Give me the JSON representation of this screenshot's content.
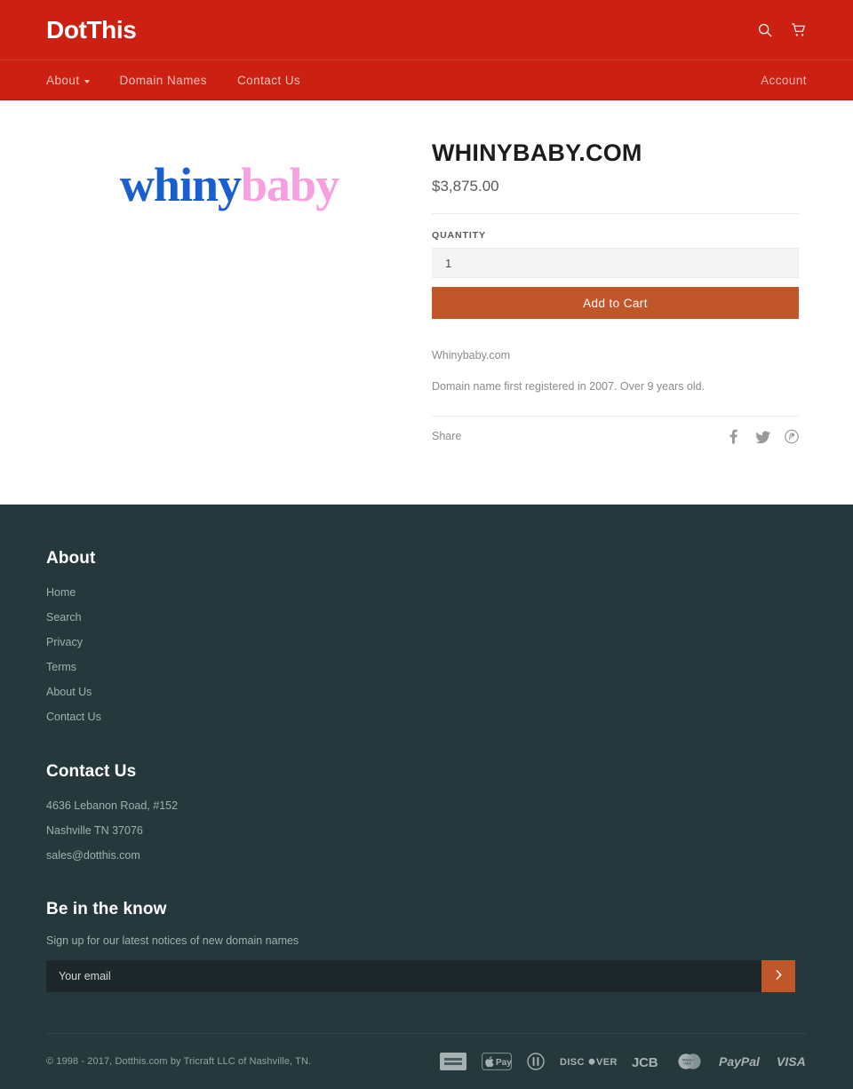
{
  "header": {
    "brand": "DotThis",
    "search_icon": "search-icon",
    "cart_icon": "cart-icon"
  },
  "nav": {
    "items": [
      {
        "label": "About",
        "has_caret": true
      },
      {
        "label": "Domain Names",
        "has_caret": false
      },
      {
        "label": "Contact Us",
        "has_caret": false
      }
    ],
    "account_label": "Account"
  },
  "product": {
    "logo_part_one": "whiny",
    "logo_part_two": "baby",
    "logo_color_one": "#1a5fd0",
    "logo_color_two": "#f79fdf",
    "title": "WHINYBABY.COM",
    "price": "$3,875.00",
    "quantity_label": "QUANTITY",
    "quantity_value": "1",
    "add_to_cart_label": "Add to Cart",
    "description_line_1": "Whinybaby.com",
    "description_line_2": "Domain name first registered in 2007.  Over 9 years old.",
    "share_label": "Share",
    "share_icons": [
      "facebook-icon",
      "twitter-icon",
      "pinterest-icon"
    ],
    "accent_color": "#c0562a"
  },
  "footer": {
    "about_heading": "About",
    "about_links": [
      "Home",
      "Search",
      "Privacy",
      "Terms",
      "About Us",
      "Contact Us"
    ],
    "contact_heading": "Contact Us",
    "contact_lines": [
      "4636 Lebanon Road, #152",
      "Nashville TN 37076",
      "sales@dotthis.com"
    ],
    "newsletter_heading": "Be in the know",
    "newsletter_subtext": "Sign up for our latest notices of new domain names",
    "newsletter_placeholder": "Your email",
    "newsletter_submit_icon": "chevron-right-icon",
    "copyright": "© 1998 - 2017, Dotthis.com by Tricraft LLC of Nashville, TN.",
    "payment_methods": [
      "american-express-icon",
      "apple-pay-icon",
      "diners-club-icon",
      "discover-icon",
      "jcb-icon",
      "mastercard-icon",
      "paypal-icon",
      "visa-icon"
    ],
    "payment_labels": {
      "discover": "DISCOVER",
      "jcb": "JCB",
      "paypal": "PayPal",
      "visa": "VISA",
      "apple_pay": "Pay"
    },
    "background_color": "#25383c"
  }
}
